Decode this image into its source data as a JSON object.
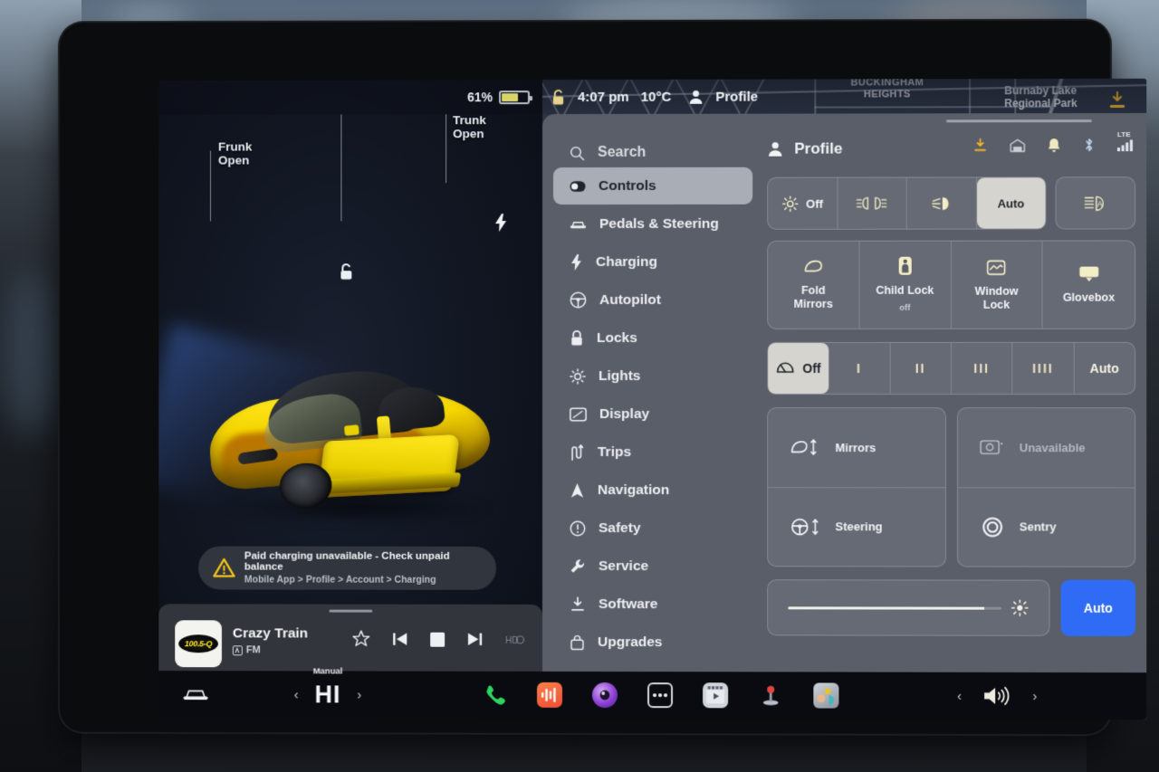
{
  "status_left": {
    "battery_percent": "61%",
    "battery_level": 61
  },
  "status_right": {
    "time": "4:07 pm",
    "temperature": "10°C",
    "profile": "Profile",
    "lock_icon": "unlock-icon"
  },
  "map": {
    "label_neighborhood": "BUCKINGHAM\nHEIGHTS",
    "label_park": "Burnaby Lake\nRegional Park",
    "download_icon": "download-icon"
  },
  "vehicle_view": {
    "frunk_label": "Frunk\nOpen",
    "trunk_label": "Trunk\nOpen",
    "unlock_icon": "unlock-icon",
    "charge_icon": "charge-bolt-icon",
    "car_color": "#ffe81f"
  },
  "alert": {
    "icon": "warning-triangle-icon",
    "title": "Paid charging unavailable - Check unpaid balance",
    "path": "Mobile App > Profile > Account > Charging",
    "accent": "#f0c419"
  },
  "media": {
    "station_logo": "100.5-Q",
    "track_title": "Crazy Train",
    "source": "FM",
    "buttons": [
      {
        "name": "favorite-star-button",
        "icon": "star-icon"
      },
      {
        "name": "previous-track-button",
        "icon": "skip-back-icon"
      },
      {
        "name": "stop-button",
        "icon": "stop-square-icon"
      },
      {
        "name": "next-track-button",
        "icon": "skip-forward-icon"
      },
      {
        "name": "hd-radio-indicator",
        "icon": "hd-icon"
      }
    ]
  },
  "controls": {
    "search_label": "Search",
    "menu": [
      {
        "label": "Controls",
        "icon": "toggle-icon",
        "active": true
      },
      {
        "label": "Pedals & Steering",
        "icon": "car-icon",
        "active": false
      },
      {
        "label": "Charging",
        "icon": "bolt-icon",
        "active": false
      },
      {
        "label": "Autopilot",
        "icon": "steering-wheel-icon",
        "active": false
      },
      {
        "label": "Locks",
        "icon": "lock-icon",
        "active": false
      },
      {
        "label": "Lights",
        "icon": "sun-icon",
        "active": false
      },
      {
        "label": "Display",
        "icon": "display-icon",
        "active": false
      },
      {
        "label": "Trips",
        "icon": "trips-icon",
        "active": false
      },
      {
        "label": "Navigation",
        "icon": "navigation-arrow-icon",
        "active": false
      },
      {
        "label": "Safety",
        "icon": "warning-circle-icon",
        "active": false
      },
      {
        "label": "Service",
        "icon": "wrench-icon",
        "active": false
      },
      {
        "label": "Software",
        "icon": "download-icon",
        "active": false
      },
      {
        "label": "Upgrades",
        "icon": "bag-icon",
        "active": false
      }
    ],
    "profile_header": {
      "label": "Profile",
      "icon": "person-icon"
    },
    "status_icons": [
      {
        "name": "software-download-icon",
        "color": "#f0b429"
      },
      {
        "name": "garage-homelink-icon",
        "color": "#c9ccd3"
      },
      {
        "name": "notification-bell-icon",
        "color": "#efe8c0"
      },
      {
        "name": "bluetooth-icon",
        "color": "#d4d7dd"
      },
      {
        "name": "lte-signal-icon",
        "color": "#e4e7ec",
        "label": "LTE"
      }
    ],
    "headlights": {
      "options": [
        {
          "label": "Off",
          "icon": "headlight-off-icon",
          "selected": false
        },
        {
          "label": "",
          "icon": "parking-lights-icon",
          "selected": false
        },
        {
          "label": "",
          "icon": "low-beam-icon",
          "selected": false
        },
        {
          "label": "Auto",
          "icon": "",
          "selected": true
        }
      ],
      "auto_highbeam": {
        "name": "auto-high-beam-button",
        "icon": "auto-highbeam-icon"
      }
    },
    "tiles": [
      {
        "label": "Fold\nMirrors",
        "sub": "",
        "icon": "mirror-icon"
      },
      {
        "label": "Child Lock",
        "sub": "off",
        "icon": "child-lock-icon"
      },
      {
        "label": "Window\nLock",
        "sub": "",
        "icon": "window-lock-icon"
      },
      {
        "label": "Glovebox",
        "sub": "",
        "icon": "glovebox-icon"
      }
    ],
    "wipers": {
      "options": [
        {
          "label": "Off",
          "icon": "wiper-icon",
          "selected": true
        },
        {
          "label": "I",
          "icon": "",
          "selected": false
        },
        {
          "label": "II",
          "icon": "",
          "selected": false
        },
        {
          "label": "III",
          "icon": "",
          "selected": false
        },
        {
          "label": "IIII",
          "icon": "",
          "selected": false
        },
        {
          "label": "Auto",
          "icon": "",
          "selected": false
        }
      ]
    },
    "adjust_rows": [
      {
        "label": "Mirrors",
        "icon": "mirror-adjust-icon",
        "dim": false
      },
      {
        "label": "Steering",
        "icon": "steering-adjust-icon",
        "dim": false
      },
      {
        "label": "Unavailable",
        "icon": "dashcam-icon",
        "dim": true
      },
      {
        "label": "Sentry",
        "icon": "sentry-icon",
        "dim": false
      }
    ],
    "brightness": {
      "value": 92,
      "sun_icon": "brightness-sun-icon",
      "auto_label": "Auto",
      "auto_color": "#2f6bf5"
    }
  },
  "taskbar": {
    "car_icon": "car-icon",
    "climate": {
      "mode": "Manual",
      "temperature": "HI",
      "left_icon": "chevron-left-icon",
      "right_icon": "chevron-right-icon"
    },
    "apps": [
      {
        "name": "phone-app-icon",
        "color": "#2fd45e"
      },
      {
        "name": "media-app-icon",
        "color": "#f2603c"
      },
      {
        "name": "camera-app-icon",
        "color": "#8b3fd6"
      },
      {
        "name": "app-launcher-icon",
        "color": "#d4d7dd"
      },
      {
        "name": "theater-app-icon",
        "color": "#c9ccd3"
      },
      {
        "name": "arcade-app-icon",
        "color": "#e04545"
      },
      {
        "name": "toybox-app-icon",
        "color": "#f0c419"
      }
    ],
    "volume": {
      "icon": "volume-icon",
      "left_icon": "chevron-left-icon",
      "right_icon": "chevron-right-icon"
    }
  }
}
